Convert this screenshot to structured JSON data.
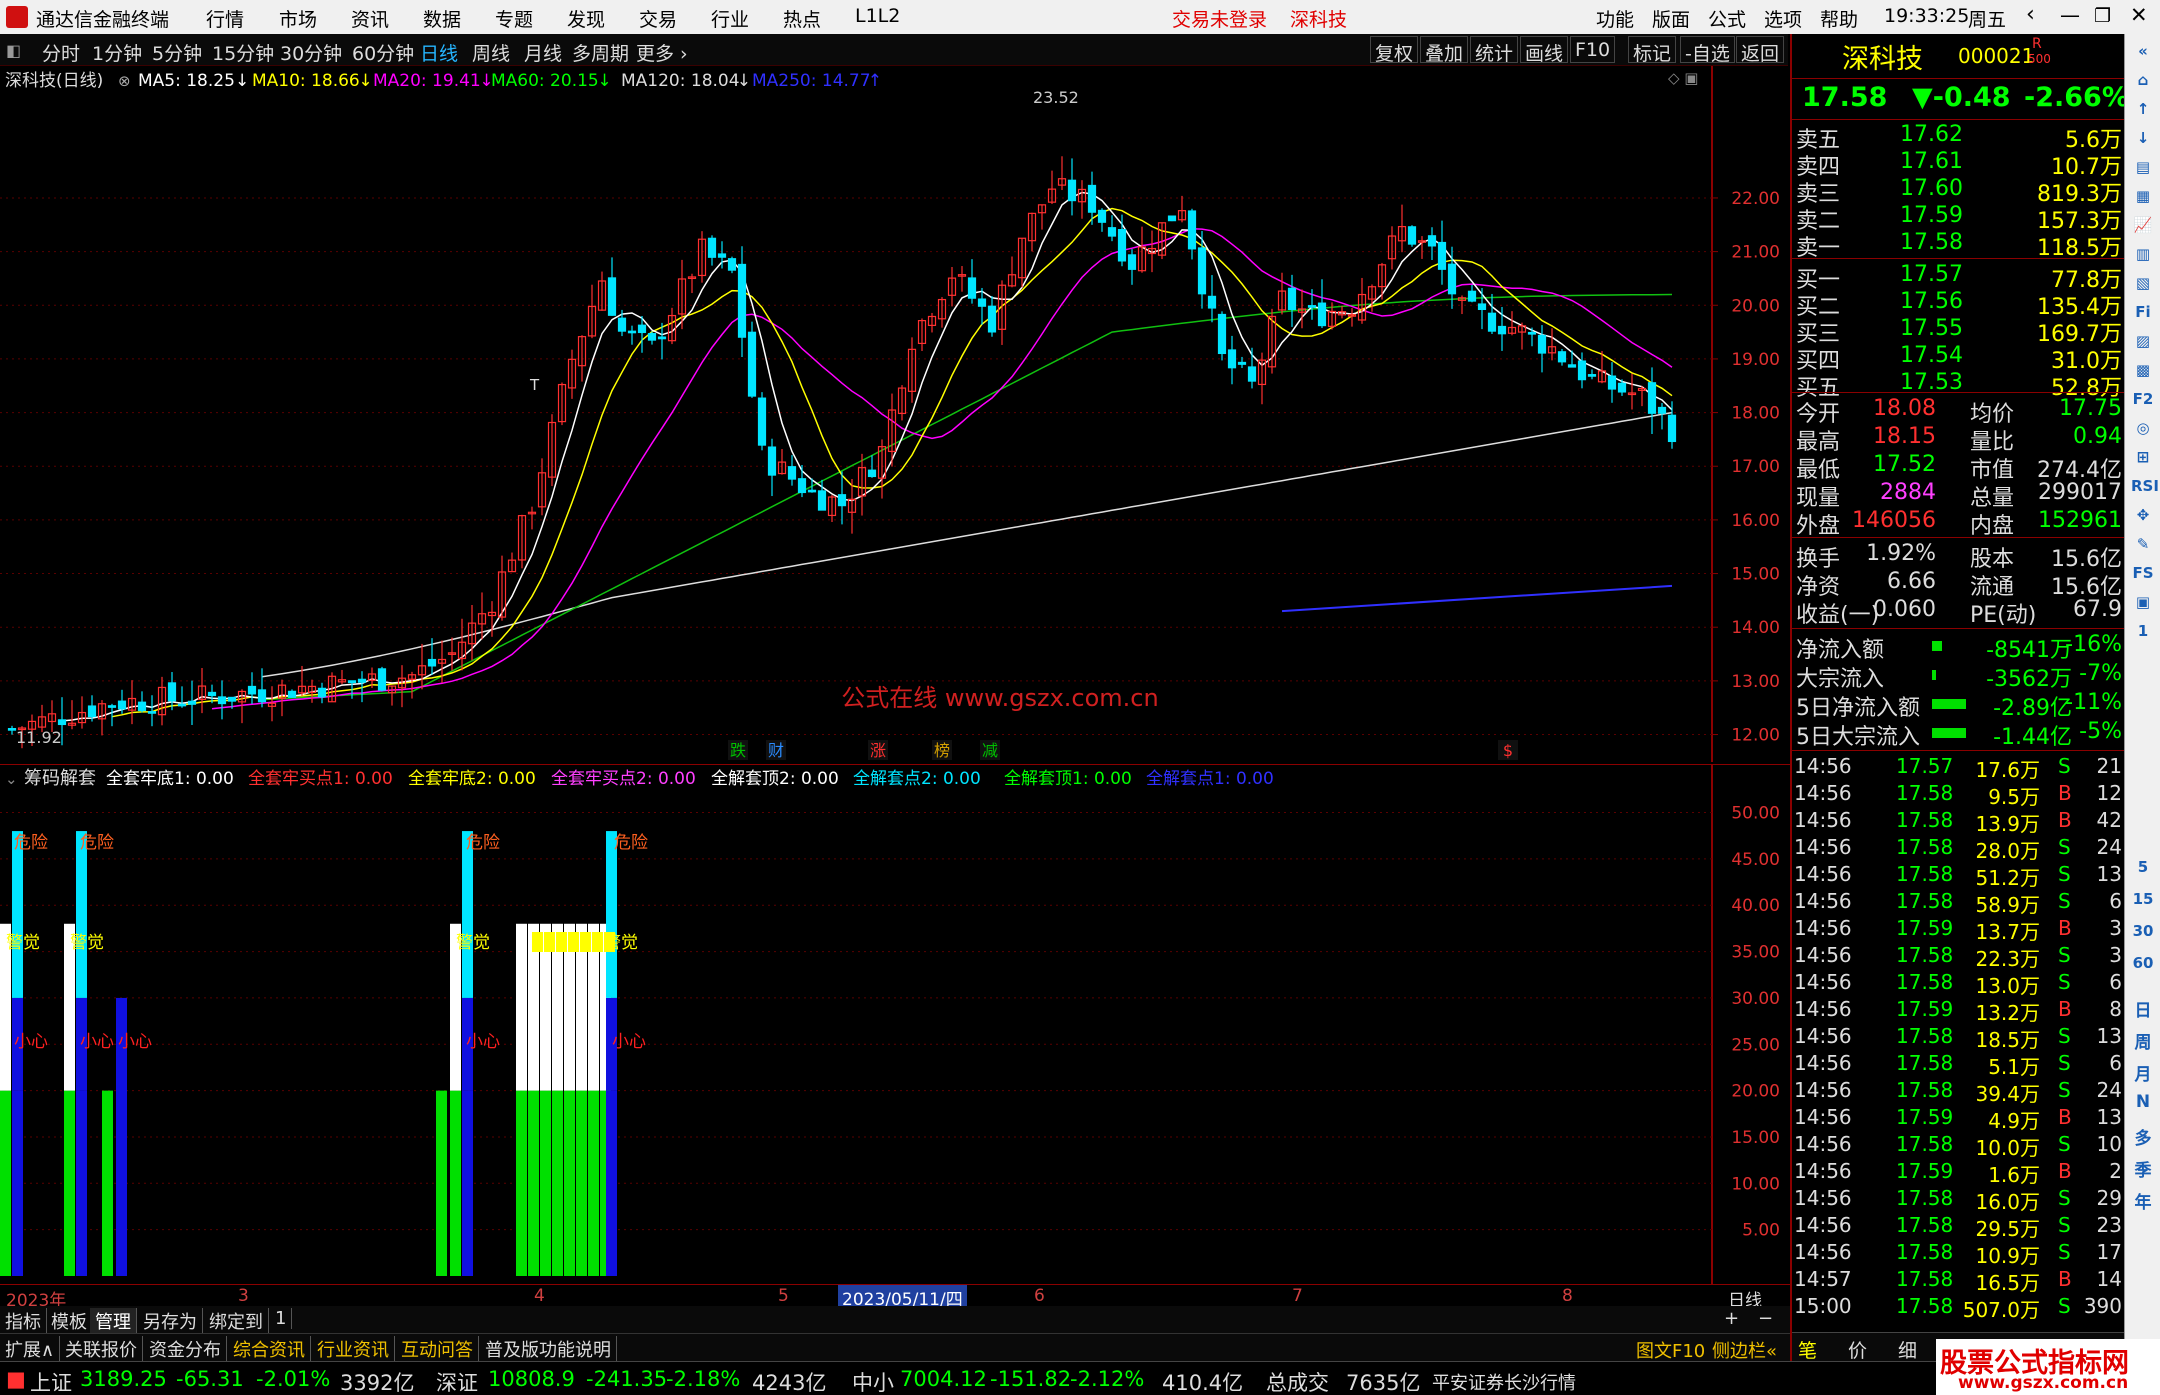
{
  "titlebar": {
    "app_name": "通达信金融终端",
    "menu": [
      "行情",
      "市场",
      "资讯",
      "数据",
      "专题",
      "发现",
      "交易",
      "行业",
      "热点",
      "L1L2"
    ],
    "login_status": "交易未登录",
    "stock_title": "深科技",
    "right_menu": [
      "功能",
      "版面",
      "公式",
      "选项",
      "帮助"
    ],
    "clock": "19:33:25",
    "weekday": "周五"
  },
  "periodbar": {
    "periods": [
      "分时",
      "1分钟",
      "5分钟",
      "15分钟",
      "30分钟",
      "60分钟",
      "日线",
      "周线",
      "月线",
      "多周期",
      "更多"
    ],
    "active": "日线",
    "tools": [
      "复权",
      "叠加",
      "统计",
      "画线",
      "F10",
      "标记",
      "-自选",
      "返回"
    ]
  },
  "ma_legend": {
    "stock": "深科技(日线)",
    "items": [
      {
        "label": "MA5: 18.25",
        "arrow": "↓",
        "color": "#ffffff"
      },
      {
        "label": "MA10: 18.66",
        "arrow": "↓",
        "color": "#ffff00"
      },
      {
        "label": "MA20: 19.41",
        "arrow": "↓",
        "color": "#ff00ff"
      },
      {
        "label": "MA60: 20.15",
        "arrow": "↓",
        "color": "#00ff00"
      },
      {
        "label": "MA120: 18.04",
        "arrow": "↓",
        "color": "#dddddd"
      },
      {
        "label": "MA250: 14.77",
        "arrow": "↑",
        "color": "#3030ff"
      }
    ]
  },
  "chart_data": {
    "type": "candlestick",
    "price_axis": [
      "22.00",
      "21.00",
      "20.00",
      "19.00",
      "18.00",
      "17.00",
      "16.00",
      "15.00",
      "14.00",
      "13.00",
      "12.00"
    ],
    "ylim": [
      11.6,
      23.9
    ],
    "high_label": "23.52",
    "low_label": "11.92",
    "watermark": "公式在线  www.gszx.com.cn",
    "date_axis": [
      "2023年",
      "3",
      "4",
      "5",
      "2023/05/11/四",
      "6",
      "7",
      "8",
      "日线"
    ],
    "event_tags": [
      {
        "label": "跌",
        "color": "#00c000"
      },
      {
        "label": "财",
        "color": "#2a8cff"
      },
      {
        "label": "涨",
        "color": "#ff3030"
      },
      {
        "label": "榜",
        "color": "#d4a000"
      },
      {
        "label": "减",
        "color": "#00c000"
      },
      {
        "label": "$",
        "color": "#ff3030"
      }
    ],
    "t_marker": "T"
  },
  "indicator": {
    "name": "筹码解套",
    "items": [
      {
        "label": "全套牢底1: 0.00",
        "color": "#ffffff"
      },
      {
        "label": "全套牢买点1: 0.00",
        "color": "#ff3030"
      },
      {
        "label": "全套牢底2: 0.00",
        "color": "#ffff00"
      },
      {
        "label": "全套牢买点2: 0.00",
        "color": "#ff40ff"
      },
      {
        "label": "全解套顶2: 0.00",
        "color": "#ffffff"
      },
      {
        "label": "全解套点2: 0.00",
        "color": "#00e5ff"
      },
      {
        "label": "全解套顶1: 0.00",
        "color": "#00ff00"
      },
      {
        "label": "全解套点1: 0.00",
        "color": "#3030ff"
      }
    ],
    "yaxis": [
      "50.00",
      "45.00",
      "40.00",
      "35.00",
      "30.00",
      "25.00",
      "20.00",
      "15.00",
      "10.00",
      "5.00"
    ],
    "danger_label": "危险",
    "alert_label": "警觉",
    "caution_label": "小心"
  },
  "quote": {
    "name": "深科技",
    "code": "000021",
    "badge": "R",
    "badge2": "500",
    "price": "17.58",
    "change": "▼-0.48",
    "pct": "-2.66%",
    "asks": [
      {
        "l": "卖五",
        "p": "17.62",
        "v": "5.6万"
      },
      {
        "l": "卖四",
        "p": "17.61",
        "v": "10.7万"
      },
      {
        "l": "卖三",
        "p": "17.60",
        "v": "819.3万"
      },
      {
        "l": "卖二",
        "p": "17.59",
        "v": "157.3万"
      },
      {
        "l": "卖一",
        "p": "17.58",
        "v": "118.5万"
      }
    ],
    "bids": [
      {
        "l": "买一",
        "p": "17.57",
        "v": "77.8万"
      },
      {
        "l": "买二",
        "p": "17.56",
        "v": "135.4万"
      },
      {
        "l": "买三",
        "p": "17.55",
        "v": "169.7万"
      },
      {
        "l": "买四",
        "p": "17.54",
        "v": "31.0万"
      },
      {
        "l": "买五",
        "p": "17.53",
        "v": "52.8万"
      }
    ],
    "stats": [
      {
        "a": "今开",
        "av": "18.08",
        "ac": "#ff3030",
        "b": "均价",
        "bv": "17.75"
      },
      {
        "a": "最高",
        "av": "18.15",
        "ac": "#ff3030",
        "b": "量比",
        "bv": "0.94"
      },
      {
        "a": "最低",
        "av": "17.52",
        "ac": "#00ff00",
        "b": "市值",
        "bv": "274.4亿"
      },
      {
        "a": "现量",
        "av": "2884",
        "ac": "#ff40ff",
        "b": "总量",
        "bv": "299017"
      },
      {
        "a": "外盘",
        "av": "146056",
        "ac": "#ff3030",
        "b": "内盘",
        "bv": "152961"
      }
    ],
    "fund": [
      {
        "a": "换手",
        "av": "1.92%",
        "b": "股本",
        "bv": "15.6亿"
      },
      {
        "a": "净资",
        "av": "6.66",
        "b": "流通",
        "bv": "15.6亿"
      },
      {
        "a": "收益(一)",
        "av": "0.060",
        "b": "PE(动)",
        "bv": "67.9"
      }
    ],
    "flow": [
      {
        "l": "净流入额",
        "v": "-8541万",
        "p": "-16%"
      },
      {
        "l": "大宗流入",
        "v": "-3562万",
        "p": "-7%"
      },
      {
        "l": "5日净流入额",
        "v": "-2.89亿",
        "p": "-11%"
      },
      {
        "l": "5日大宗流入",
        "v": "-1.44亿",
        "p": "-5%"
      }
    ],
    "ticks": [
      {
        "t": "14:56",
        "p": "17.57",
        "v": "17.6万",
        "s": "S",
        "n": "21"
      },
      {
        "t": "14:56",
        "p": "17.58",
        "v": "9.5万",
        "s": "B",
        "n": "12"
      },
      {
        "t": "14:56",
        "p": "17.58",
        "v": "13.9万",
        "s": "B",
        "n": "42"
      },
      {
        "t": "14:56",
        "p": "17.58",
        "v": "28.0万",
        "s": "S",
        "n": "24"
      },
      {
        "t": "14:56",
        "p": "17.58",
        "v": "51.2万",
        "s": "S",
        "n": "13"
      },
      {
        "t": "14:56",
        "p": "17.58",
        "v": "58.9万",
        "s": "S",
        "n": "6"
      },
      {
        "t": "14:56",
        "p": "17.59",
        "v": "13.7万",
        "s": "B",
        "n": "3"
      },
      {
        "t": "14:56",
        "p": "17.58",
        "v": "22.3万",
        "s": "S",
        "n": "3"
      },
      {
        "t": "14:56",
        "p": "17.58",
        "v": "13.0万",
        "s": "S",
        "n": "6"
      },
      {
        "t": "14:56",
        "p": "17.59",
        "v": "13.2万",
        "s": "B",
        "n": "8"
      },
      {
        "t": "14:56",
        "p": "17.58",
        "v": "18.5万",
        "s": "S",
        "n": "13"
      },
      {
        "t": "14:56",
        "p": "17.58",
        "v": "5.1万",
        "s": "S",
        "n": "6"
      },
      {
        "t": "14:56",
        "p": "17.58",
        "v": "39.4万",
        "s": "S",
        "n": "24"
      },
      {
        "t": "14:56",
        "p": "17.59",
        "v": "4.9万",
        "s": "B",
        "n": "13"
      },
      {
        "t": "14:56",
        "p": "17.58",
        "v": "10.0万",
        "s": "S",
        "n": "10"
      },
      {
        "t": "14:56",
        "p": "17.59",
        "v": "1.6万",
        "s": "B",
        "n": "2"
      },
      {
        "t": "14:56",
        "p": "17.58",
        "v": "16.0万",
        "s": "S",
        "n": "29"
      },
      {
        "t": "14:56",
        "p": "17.58",
        "v": "29.5万",
        "s": "S",
        "n": "23"
      },
      {
        "t": "14:56",
        "p": "17.58",
        "v": "10.9万",
        "s": "S",
        "n": "17"
      },
      {
        "t": "14:57",
        "p": "17.58",
        "v": "16.5万",
        "s": "B",
        "n": "14"
      },
      {
        "t": "15:00",
        "p": "17.58",
        "v": "507.0万",
        "s": "S",
        "n": "390"
      }
    ],
    "bottom_tabs": [
      "笔",
      "价",
      "细",
      "势"
    ]
  },
  "tabs": {
    "row1": [
      "指标",
      "模板",
      "管理",
      "另存为",
      "绑定到",
      "1"
    ],
    "row2": [
      "扩展∧",
      "关联报价",
      "资金分布",
      "综合资讯",
      "行业资讯",
      "互动问答",
      "普及版功能说明"
    ],
    "right": [
      "图文F10",
      "侧边栏«"
    ],
    "zoom": [
      "+",
      "−"
    ]
  },
  "statusbar": {
    "sh_label": "上证",
    "sh": "3189.25",
    "sh_ch": "-65.31",
    "sh_pct": "-2.01%",
    "sh_amt": "3392亿",
    "sz_label": "深证",
    "sz": "10808.9",
    "sz_ch": "-241.35",
    "sz_pct": "-2.18%",
    "sz_amt": "4243亿",
    "zx_label": "中小",
    "zx": "7004.12",
    "zx_ch": "-151.82",
    "zx_pct": "-2.12%",
    "zx_amt": "410.4亿",
    "total_label": "总成交",
    "total": "7635亿",
    "broker": "平安证券长沙行情",
    "watermark_logo": "股票公式指标网",
    "watermark_url": "www.gszx.com.cn"
  },
  "sideicons": [
    "日",
    "周",
    "月",
    "N",
    "多",
    "季",
    "年"
  ],
  "sideicon_nums": [
    "5",
    "15",
    "30",
    "60"
  ],
  "sideicon_glyphs": [
    "«",
    "⌂",
    "↑",
    "↓",
    "▤",
    "▦",
    "📈",
    "▥",
    "▧",
    "Fi",
    "▨",
    "▩",
    "F2",
    "◎",
    "⊞",
    "RSI",
    "✥",
    "✎",
    "FS",
    "▣",
    "1"
  ]
}
